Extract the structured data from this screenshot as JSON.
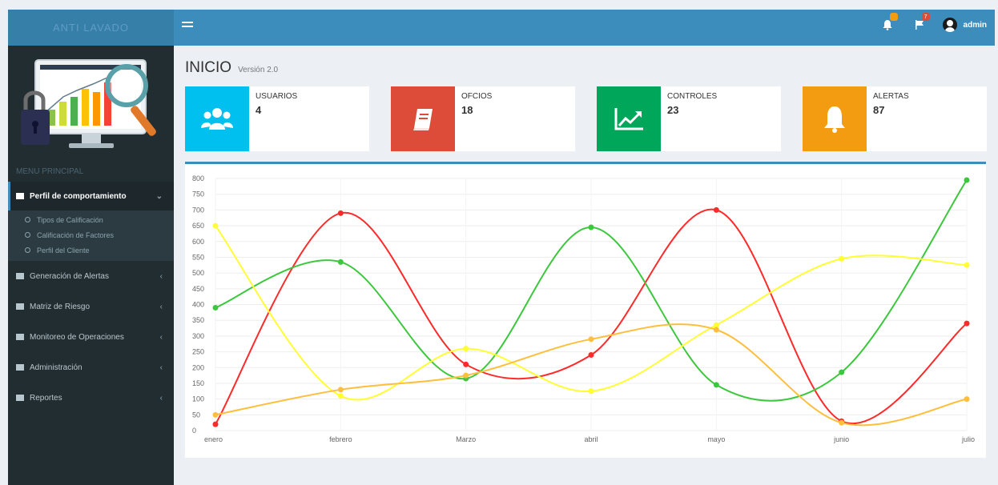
{
  "header": {
    "logo_text": "ANTI LAVADO",
    "notif_badge": "",
    "flag_badge": "7",
    "user_name": "admin"
  },
  "sidebar": {
    "menu_header": "MENU PRINCIPAL",
    "items": [
      {
        "label": "Perfil de comportamiento",
        "active": true
      },
      {
        "label": "Generación de Alertas"
      },
      {
        "label": "Matriz de Riesgo"
      },
      {
        "label": "Monitoreo de Operaciones"
      },
      {
        "label": "Administración"
      },
      {
        "label": "Reportes"
      }
    ],
    "subitems": [
      "Tipos de Calificación",
      "Calificación de Factores",
      "Perfil del Cliente"
    ]
  },
  "page": {
    "title": "INICIO",
    "subtitle": "Versión 2.0"
  },
  "info_boxes": [
    {
      "label": "USUARIOS",
      "value": "4",
      "color": "#00c0ef",
      "icon": "users-icon"
    },
    {
      "label": "OFCIOS",
      "value": "18",
      "color": "#dd4b39",
      "icon": "book-icon"
    },
    {
      "label": "CONTROLES",
      "value": "23",
      "color": "#00a65a",
      "icon": "trend-chart-icon"
    },
    {
      "label": "ALERTAS",
      "value": "87",
      "color": "#f39c12",
      "icon": "bell-icon"
    }
  ],
  "chart_data": {
    "type": "line",
    "categories": [
      "enero",
      "febrero",
      "Marzo",
      "abril",
      "mayo",
      "junio",
      "julio"
    ],
    "ylim": [
      0,
      800
    ],
    "yticks": [
      0,
      50,
      100,
      150,
      200,
      250,
      300,
      350,
      400,
      450,
      500,
      550,
      600,
      650,
      700,
      750,
      800
    ],
    "grid": true,
    "series": [
      {
        "color": "#ff2a2a",
        "values": [
          20,
          690,
          210,
          240,
          700,
          30,
          340
        ]
      },
      {
        "color": "#3cc83c",
        "values": [
          390,
          535,
          165,
          645,
          145,
          185,
          795
        ]
      },
      {
        "color": "#ffff33",
        "values": [
          650,
          110,
          260,
          125,
          335,
          545,
          525
        ]
      },
      {
        "color": "#ffbe3c",
        "values": [
          50,
          130,
          175,
          290,
          320,
          25,
          100
        ]
      }
    ]
  }
}
